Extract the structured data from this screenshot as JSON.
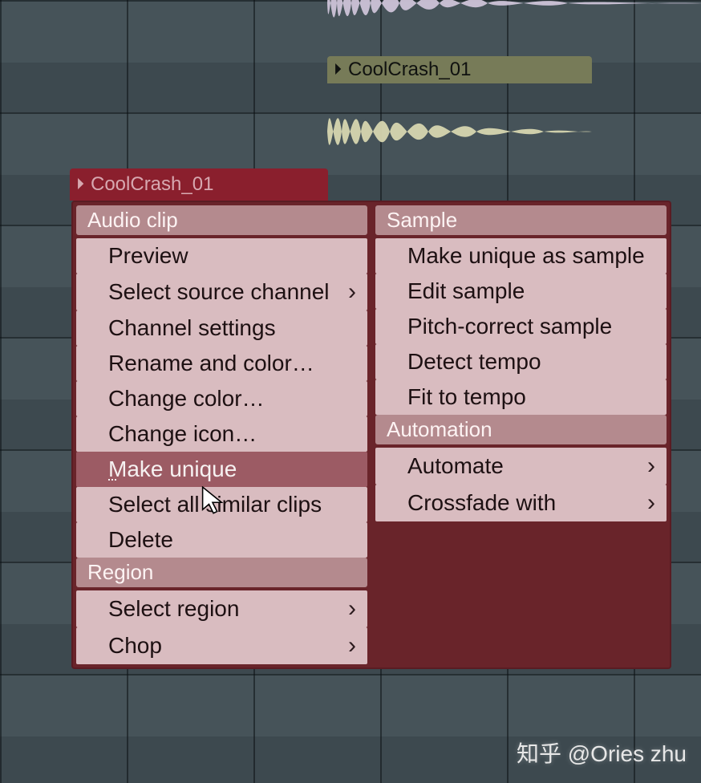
{
  "clips": {
    "a": {
      "name": ""
    },
    "b": {
      "name": "CoolCrash_01"
    },
    "c": {
      "name": "CoolCrash_01"
    }
  },
  "context_menu": {
    "left": {
      "audio_clip": {
        "header": "Audio clip",
        "items": {
          "preview": {
            "label": "Preview",
            "arrow": false
          },
          "select_source": {
            "label": "Select source channel",
            "arrow": true
          },
          "channel_settings": {
            "label": "Channel settings",
            "arrow": false
          },
          "rename_color": {
            "label": "Rename and color…",
            "arrow": false
          },
          "change_color": {
            "label": "Change color…",
            "arrow": false
          },
          "change_icon": {
            "label": "Change icon…",
            "arrow": false
          },
          "make_unique": {
            "label": "Make unique",
            "arrow": false,
            "highlight": true
          },
          "select_similar": {
            "label": "Select all similar clips",
            "arrow": false
          },
          "delete": {
            "label": "Delete",
            "arrow": false
          }
        }
      },
      "region": {
        "header": "Region",
        "items": {
          "select_region": {
            "label": "Select region",
            "arrow": true
          },
          "chop": {
            "label": "Chop",
            "arrow": true
          }
        }
      }
    },
    "right": {
      "sample": {
        "header": "Sample",
        "items": {
          "make_unique_sample": {
            "label": "Make unique as sample",
            "arrow": false
          },
          "edit_sample": {
            "label": "Edit sample",
            "arrow": false
          },
          "pitch_correct": {
            "label": "Pitch-correct sample",
            "arrow": false
          },
          "detect_tempo": {
            "label": "Detect tempo",
            "arrow": false
          },
          "fit_tempo": {
            "label": "Fit to tempo",
            "arrow": false
          }
        }
      },
      "automation": {
        "header": "Automation",
        "items": {
          "automate": {
            "label": "Automate",
            "arrow": true
          },
          "crossfade_with": {
            "label": "Crossfade with",
            "arrow": true
          }
        }
      }
    }
  },
  "watermark": "知乎 @Ories zhu",
  "icons": {
    "play_triangle": "⏵"
  }
}
